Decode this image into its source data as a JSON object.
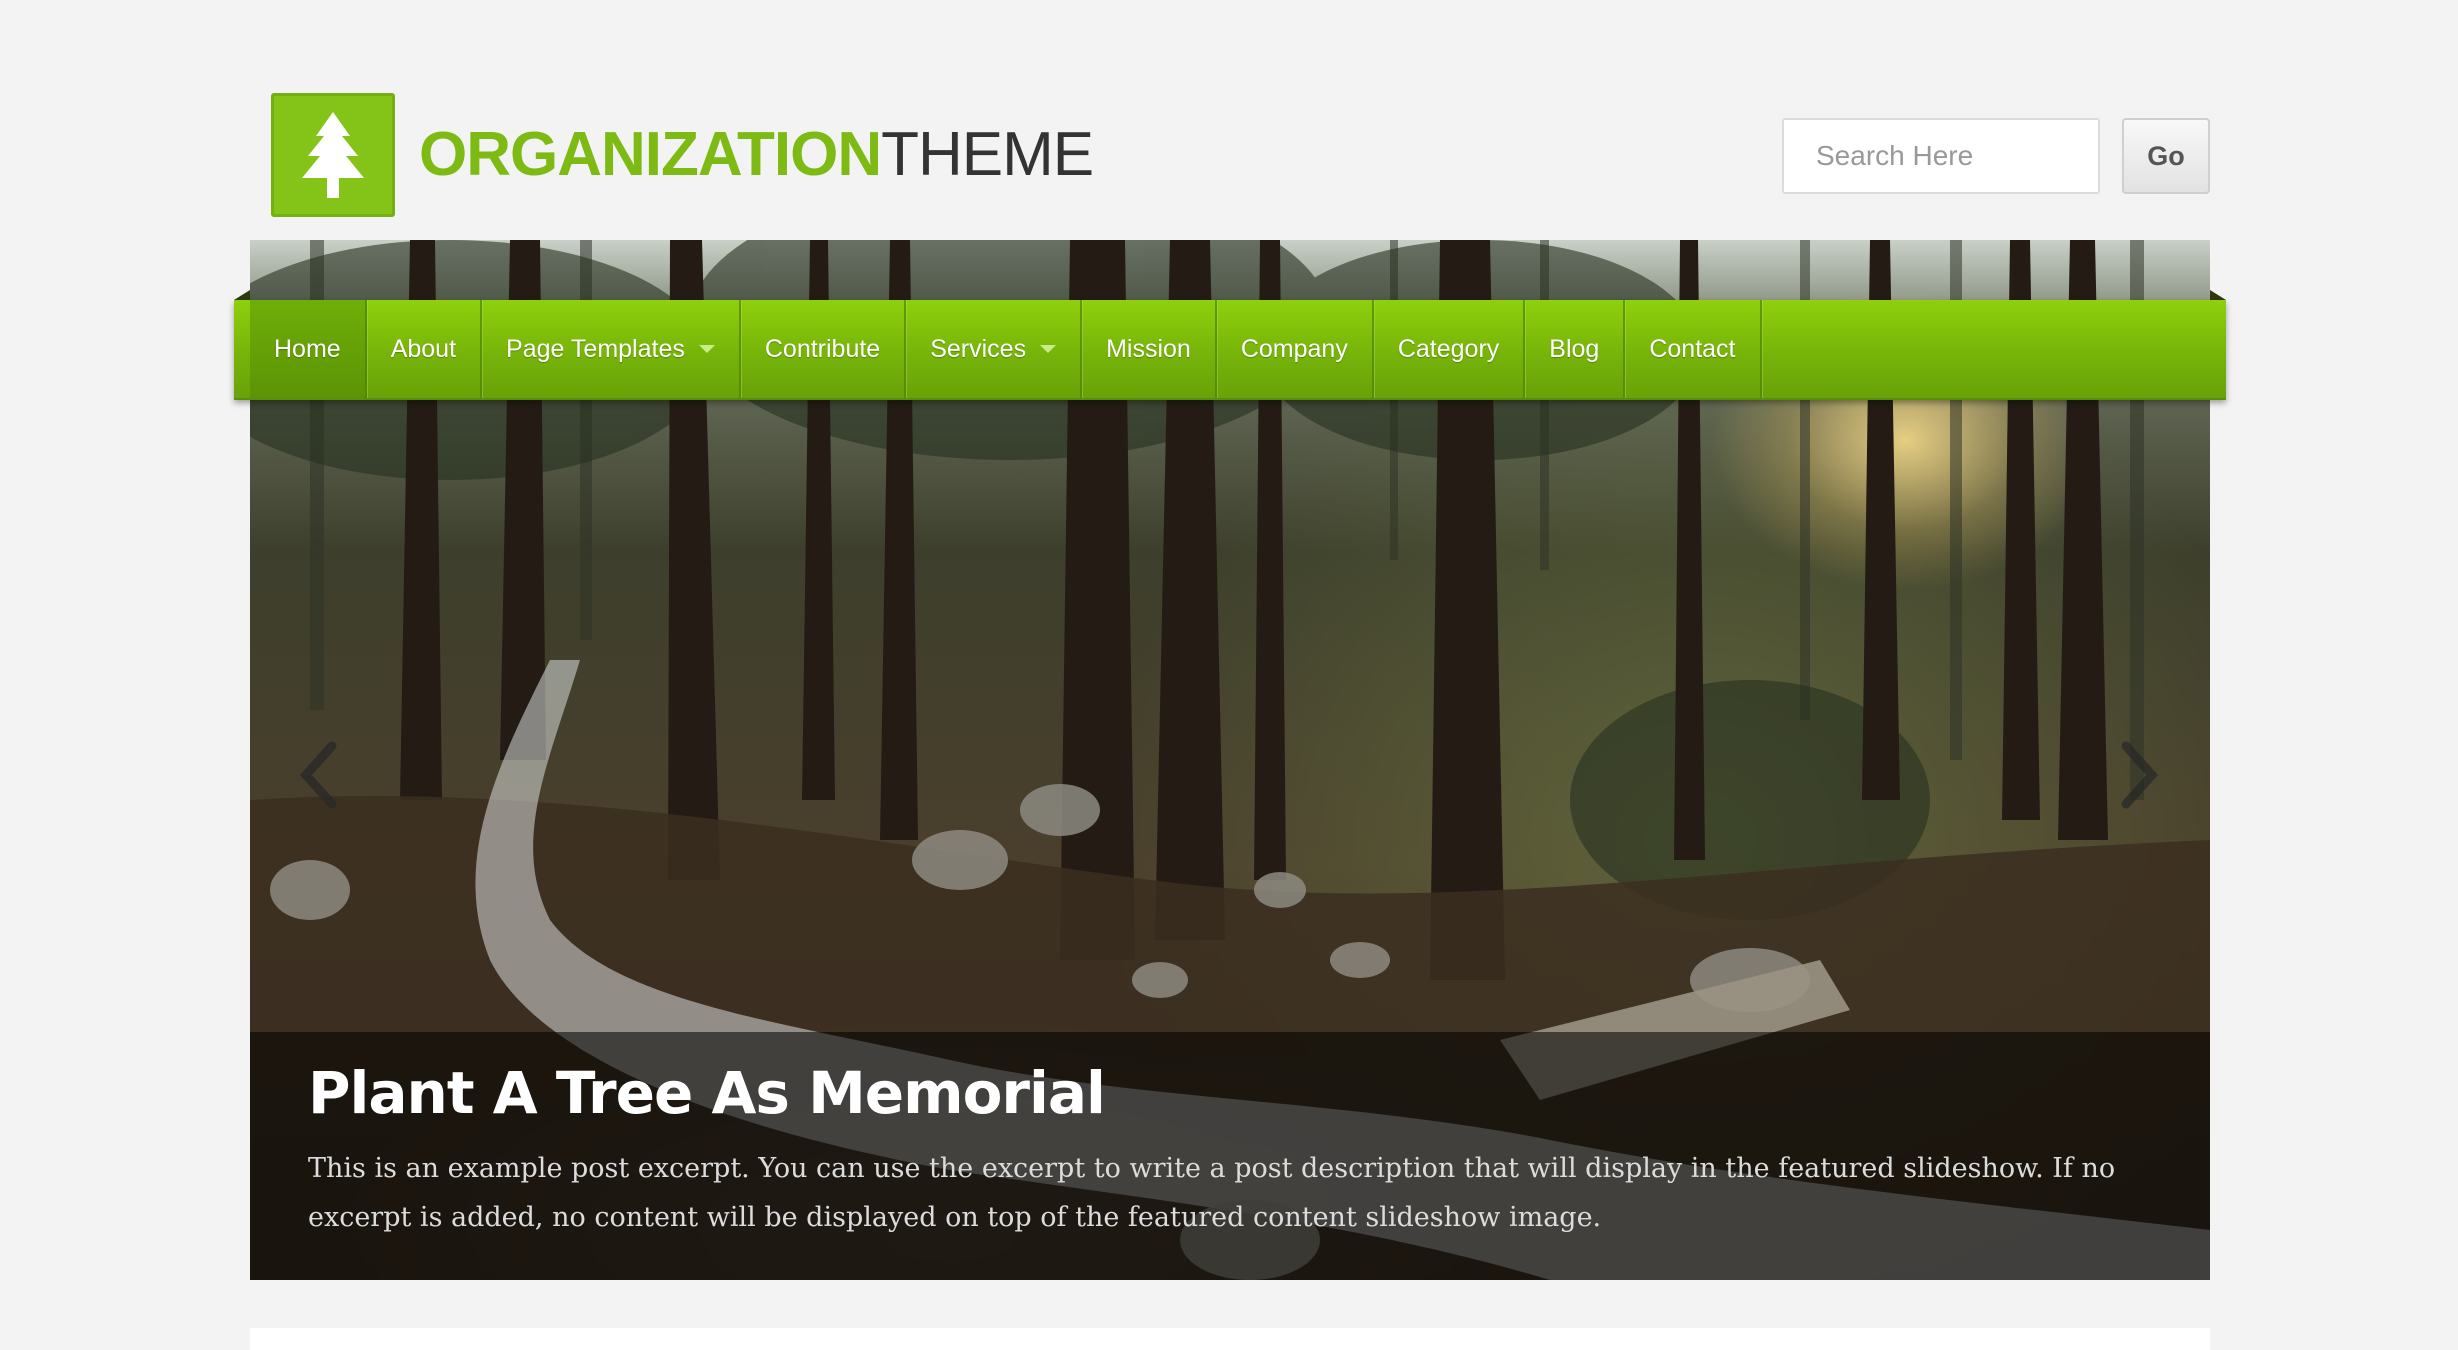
{
  "logo": {
    "text_primary": "ORGANIZATION",
    "text_secondary": "THEME",
    "mark_icon": "pine-tree-icon",
    "brand_color": "#84c418"
  },
  "search": {
    "placeholder": "Search Here",
    "button_label": "Go"
  },
  "nav": {
    "items": [
      {
        "label": "Home",
        "active": true
      },
      {
        "label": "About"
      },
      {
        "label": "Page Templates",
        "dropdown": true
      },
      {
        "label": "Contribute"
      },
      {
        "label": "Services",
        "dropdown": true
      },
      {
        "label": "Mission"
      },
      {
        "label": "Company"
      },
      {
        "label": "Category"
      },
      {
        "label": "Blog"
      },
      {
        "label": "Contact"
      }
    ],
    "dropdown_icon": "caret-down-icon",
    "accent_color": "#7dbb0e"
  },
  "slideshow": {
    "title": "Plant A Tree As Memorial",
    "excerpt": "This is an example post excerpt. You can use the excerpt to write a post description that will display in the featured slideshow. If no excerpt is added, no content will be displayed on top of the featured content slideshow image.",
    "prev_icon": "chevron-left-icon",
    "next_icon": "chevron-right-icon",
    "image": "forest-stream-photo"
  }
}
